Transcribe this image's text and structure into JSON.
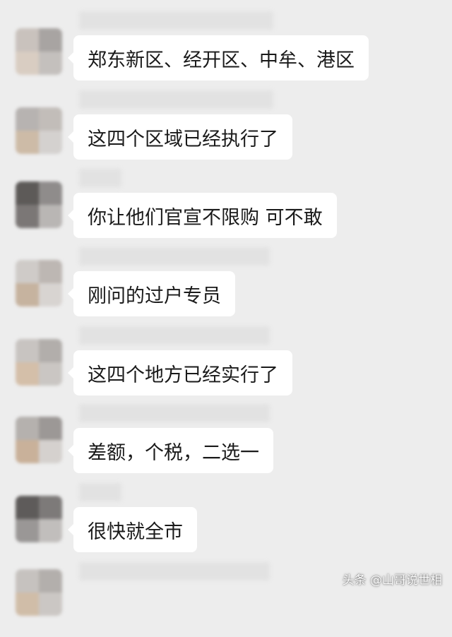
{
  "chat": {
    "messages": [
      {
        "text": "郑东新区、经开区、中牟、港区",
        "avatar_colors": [
          "#c9c2bd",
          "#a8a4a2",
          "#d9cdc2",
          "#c4c0bd"
        ]
      },
      {
        "text": "这四个区域已经执行了",
        "avatar_colors": [
          "#b7b3b1",
          "#c2bdb9",
          "#cdbba7",
          "#d4d1cf"
        ]
      },
      {
        "text": "你让他们官宣不限购 可不敢",
        "avatar_colors": [
          "#5d5a58",
          "#8f8c8b",
          "#7b7776",
          "#b9b6b4"
        ]
      },
      {
        "text": "刚问的过户专员",
        "avatar_colors": [
          "#cfcbc8",
          "#bdb7b3",
          "#c6b39f",
          "#d8d4d1"
        ]
      },
      {
        "text": "这四个地方已经实行了",
        "avatar_colors": [
          "#c8c4c1",
          "#b2aeab",
          "#d4bfa9",
          "#cac6c3"
        ]
      },
      {
        "text": "差额，个税，二选一",
        "avatar_colors": [
          "#b5b1ae",
          "#9c9896",
          "#c9b19a",
          "#d5d1ce"
        ]
      },
      {
        "text": "很快就全市",
        "avatar_colors": [
          "#5e5b5a",
          "#7d7a79",
          "#9a9796",
          "#c1bebc"
        ]
      },
      {
        "text": "",
        "avatar_colors": [
          "#c6c2bf",
          "#b3afac",
          "#d0bda8",
          "#cbc7c4"
        ]
      }
    ]
  },
  "watermark": {
    "text": "头条 @山哥说世相"
  }
}
